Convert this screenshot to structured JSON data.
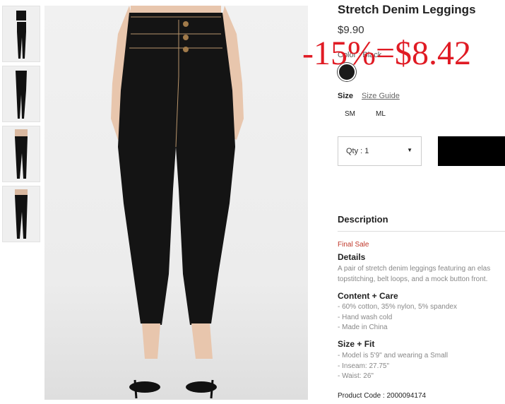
{
  "product": {
    "title": "Stretch Denim Leggings",
    "price": "$9.90",
    "promo": "-15%=$8.42",
    "color_label": "Color",
    "color_value": "Black",
    "swatch_color": "#1a1a1a",
    "size_label": "Size",
    "size_guide": "Size Guide",
    "sizes": [
      "SM",
      "ML"
    ],
    "qty_label": "Qty : 1",
    "add_button_color": "#000000"
  },
  "description": {
    "heading": "Description",
    "final_sale": "Final Sale",
    "details_heading": "Details",
    "details_lines": [
      "A pair of stretch denim leggings featuring an elas",
      "topstitching, belt loops, and a mock button front."
    ],
    "content_heading": "Content + Care",
    "content_lines": [
      "- 60% cotton, 35% nylon, 5% spandex",
      "- Hand wash cold",
      "- Made in China"
    ],
    "fit_heading": "Size + Fit",
    "fit_lines": [
      "- Model is 5'9\" and wearing a Small",
      "- Inseam: 27.75\"",
      "- Waist: 26\""
    ],
    "product_code": "Product Code : 2000094174"
  },
  "icons": {
    "caret": "caret-down-icon"
  }
}
